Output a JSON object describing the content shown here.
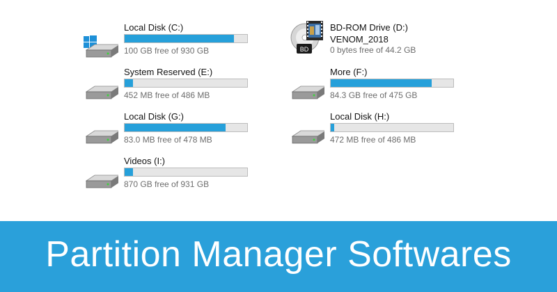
{
  "drives": [
    {
      "name": "Local Disk (C:)",
      "free": "100 GB free of 930 GB",
      "used_fraction": 0.892,
      "windows": true
    },
    {
      "name": "System Reserved (E:)",
      "free": "452 MB free of 486 MB",
      "used_fraction": 0.07
    },
    {
      "name": "Local Disk (G:)",
      "free": "83.0 MB free of 478 MB",
      "used_fraction": 0.826
    },
    {
      "name": "Videos (I:)",
      "free": "870 GB free of 931 GB",
      "used_fraction": 0.066
    },
    {
      "name": "More (F:)",
      "free": "84.3 GB free of 475 GB",
      "used_fraction": 0.822
    },
    {
      "name": "Local Disk (H:)",
      "free": "472 MB free of 486 MB",
      "used_fraction": 0.029
    }
  ],
  "optical_drive": {
    "name": "BD-ROM Drive (D:)",
    "volume": "VENOM_2018",
    "free": "0 bytes free of 44.2 GB",
    "badge": "BD"
  },
  "banner": {
    "title": "Partition Manager Softwares",
    "color": "#2aa0da"
  },
  "colors": {
    "bar_fill": "#26a0da",
    "bar_track": "#e6e6e6"
  }
}
